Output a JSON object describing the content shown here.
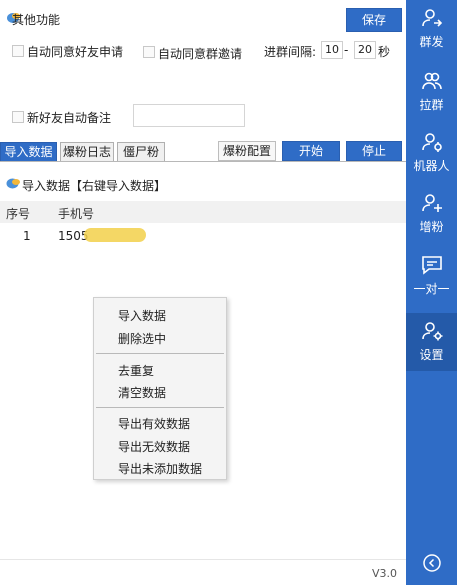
{
  "header": {
    "title": "其他功能",
    "save_label": "保存"
  },
  "options": {
    "auto_accept_friend": "自动同意好友申请",
    "auto_accept_group": "自动同意群邀请",
    "interval_label": "进群间隔:",
    "interval_min": "10",
    "interval_sep": "-",
    "interval_max": "20",
    "interval_unit": "秒",
    "new_friend_note": "新好友自动备注"
  },
  "tabs": [
    {
      "label": "导入数据"
    },
    {
      "label": "爆粉日志"
    },
    {
      "label": "僵尸粉"
    }
  ],
  "actions": {
    "config_label": "爆粉配置",
    "start_label": "开始",
    "stop_label": "停止"
  },
  "section": {
    "title": "导入数据【右键导入数据】"
  },
  "table": {
    "columns": [
      "序号",
      "手机号"
    ],
    "rows": [
      {
        "index": "1",
        "phone": "1505"
      }
    ]
  },
  "context_menu": {
    "items": [
      "导入数据",
      "删除选中",
      "去重复",
      "清空数据",
      "导出有效数据",
      "导出无效数据",
      "导出未添加数据"
    ]
  },
  "version": "V3.0",
  "sidebar": {
    "items": [
      {
        "label": "群发",
        "icon": "user-send-icon"
      },
      {
        "label": "拉群",
        "icon": "users-icon"
      },
      {
        "label": "机器人",
        "icon": "robot-user-icon"
      },
      {
        "label": "增粉",
        "icon": "user-plus-icon"
      },
      {
        "label": "一对一",
        "icon": "chat-icon"
      },
      {
        "label": "设置",
        "icon": "user-gear-icon"
      }
    ]
  },
  "colors": {
    "accent": "#2f6cc6",
    "sidebar_active": "#245aa9"
  }
}
